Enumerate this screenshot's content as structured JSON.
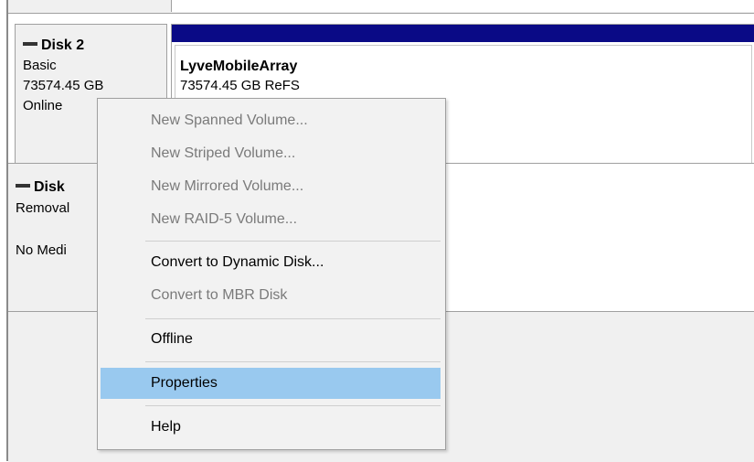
{
  "disk2": {
    "name": "Disk 2",
    "type": "Basic",
    "size": "73574.45 GB",
    "status": "Online",
    "volume": {
      "name": "LyveMobileArray",
      "detail": "73574.45 GB ReFS",
      "bar_color": "#0a0a86"
    }
  },
  "removable_disk": {
    "name_partial": "Disk",
    "type_partial": "Removal",
    "status_partial": "No Medi"
  },
  "context_menu": {
    "items": [
      {
        "label": "New Spanned Volume...",
        "enabled": false
      },
      {
        "label": "New Striped Volume...",
        "enabled": false
      },
      {
        "label": "New Mirrored Volume...",
        "enabled": false
      },
      {
        "label": "New RAID-5 Volume...",
        "enabled": false
      },
      {
        "label": "Convert to Dynamic Disk...",
        "enabled": true
      },
      {
        "label": "Convert to MBR Disk",
        "enabled": false
      },
      {
        "label": "Offline",
        "enabled": true
      },
      {
        "label": "Properties",
        "enabled": true,
        "highlighted": true
      },
      {
        "label": "Help",
        "enabled": true
      }
    ],
    "highlight_color": "#99c9ef"
  }
}
